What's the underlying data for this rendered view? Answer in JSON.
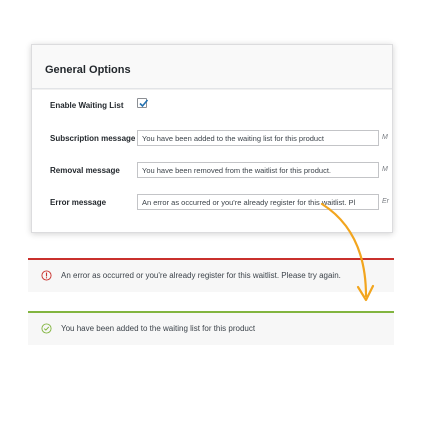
{
  "panel": {
    "title": "General Options",
    "rows": {
      "enable": {
        "label": "Enable Waiting List",
        "checked": true
      },
      "subscription": {
        "label": "Subscription message",
        "value": "You have been added to the waiting list for this product",
        "hint": "M"
      },
      "removal": {
        "label": "Removal message",
        "value": "You have been removed from the waitlist for this product.",
        "hint": "M"
      },
      "error": {
        "label": "Error message",
        "value": "An error as occurred or you're already register for this waitlist. Pl",
        "hint": "Er"
      }
    }
  },
  "notices": {
    "error": {
      "text": "An error as occurred or you're already register for this waitlist. Please try again.",
      "color": "#c9302c"
    },
    "success": {
      "text": "You have been added to the waiting list for this product",
      "color": "#82b540"
    }
  },
  "icons": {
    "checkbox_mark": "checkmark-icon",
    "error_icon": "exclamation-circle-icon",
    "success_icon": "check-circle-icon",
    "arrow": "curved-arrow-icon"
  },
  "colors": {
    "arrow": "#f2a51e",
    "checkmark": "#2271b1"
  }
}
